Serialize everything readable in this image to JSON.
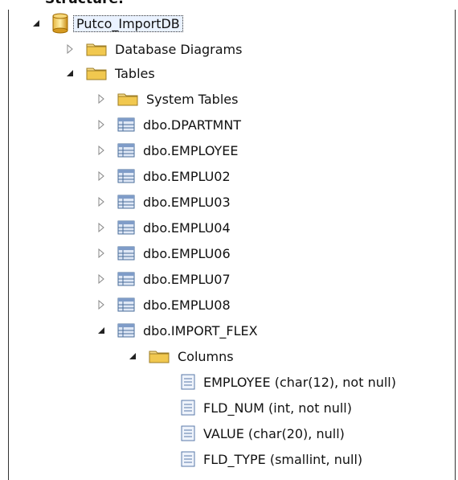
{
  "header": {
    "caption_fragment": "Structure:"
  },
  "tree": {
    "database": {
      "label": "Putco_ImportDB"
    },
    "database_diagrams": {
      "label": "Database Diagrams"
    },
    "tables": {
      "label": "Tables"
    },
    "system_tables": {
      "label": "System Tables"
    },
    "table_items": [
      {
        "label": "dbo.DPARTMNT"
      },
      {
        "label": "dbo.EMPLOYEE"
      },
      {
        "label": "dbo.EMPLU02"
      },
      {
        "label": "dbo.EMPLU03"
      },
      {
        "label": "dbo.EMPLU04"
      },
      {
        "label": "dbo.EMPLU06"
      },
      {
        "label": "dbo.EMPLU07"
      },
      {
        "label": "dbo.EMPLU08"
      },
      {
        "label": "dbo.IMPORT_FLEX"
      }
    ],
    "columns_folder": {
      "label": "Columns"
    },
    "columns": [
      {
        "label": "EMPLOYEE (char(12), not null)"
      },
      {
        "label": "FLD_NUM (int, not null)"
      },
      {
        "label": "VALUE (char(20), null)"
      },
      {
        "label": "FLD_TYPE (smallint, null)"
      }
    ]
  }
}
